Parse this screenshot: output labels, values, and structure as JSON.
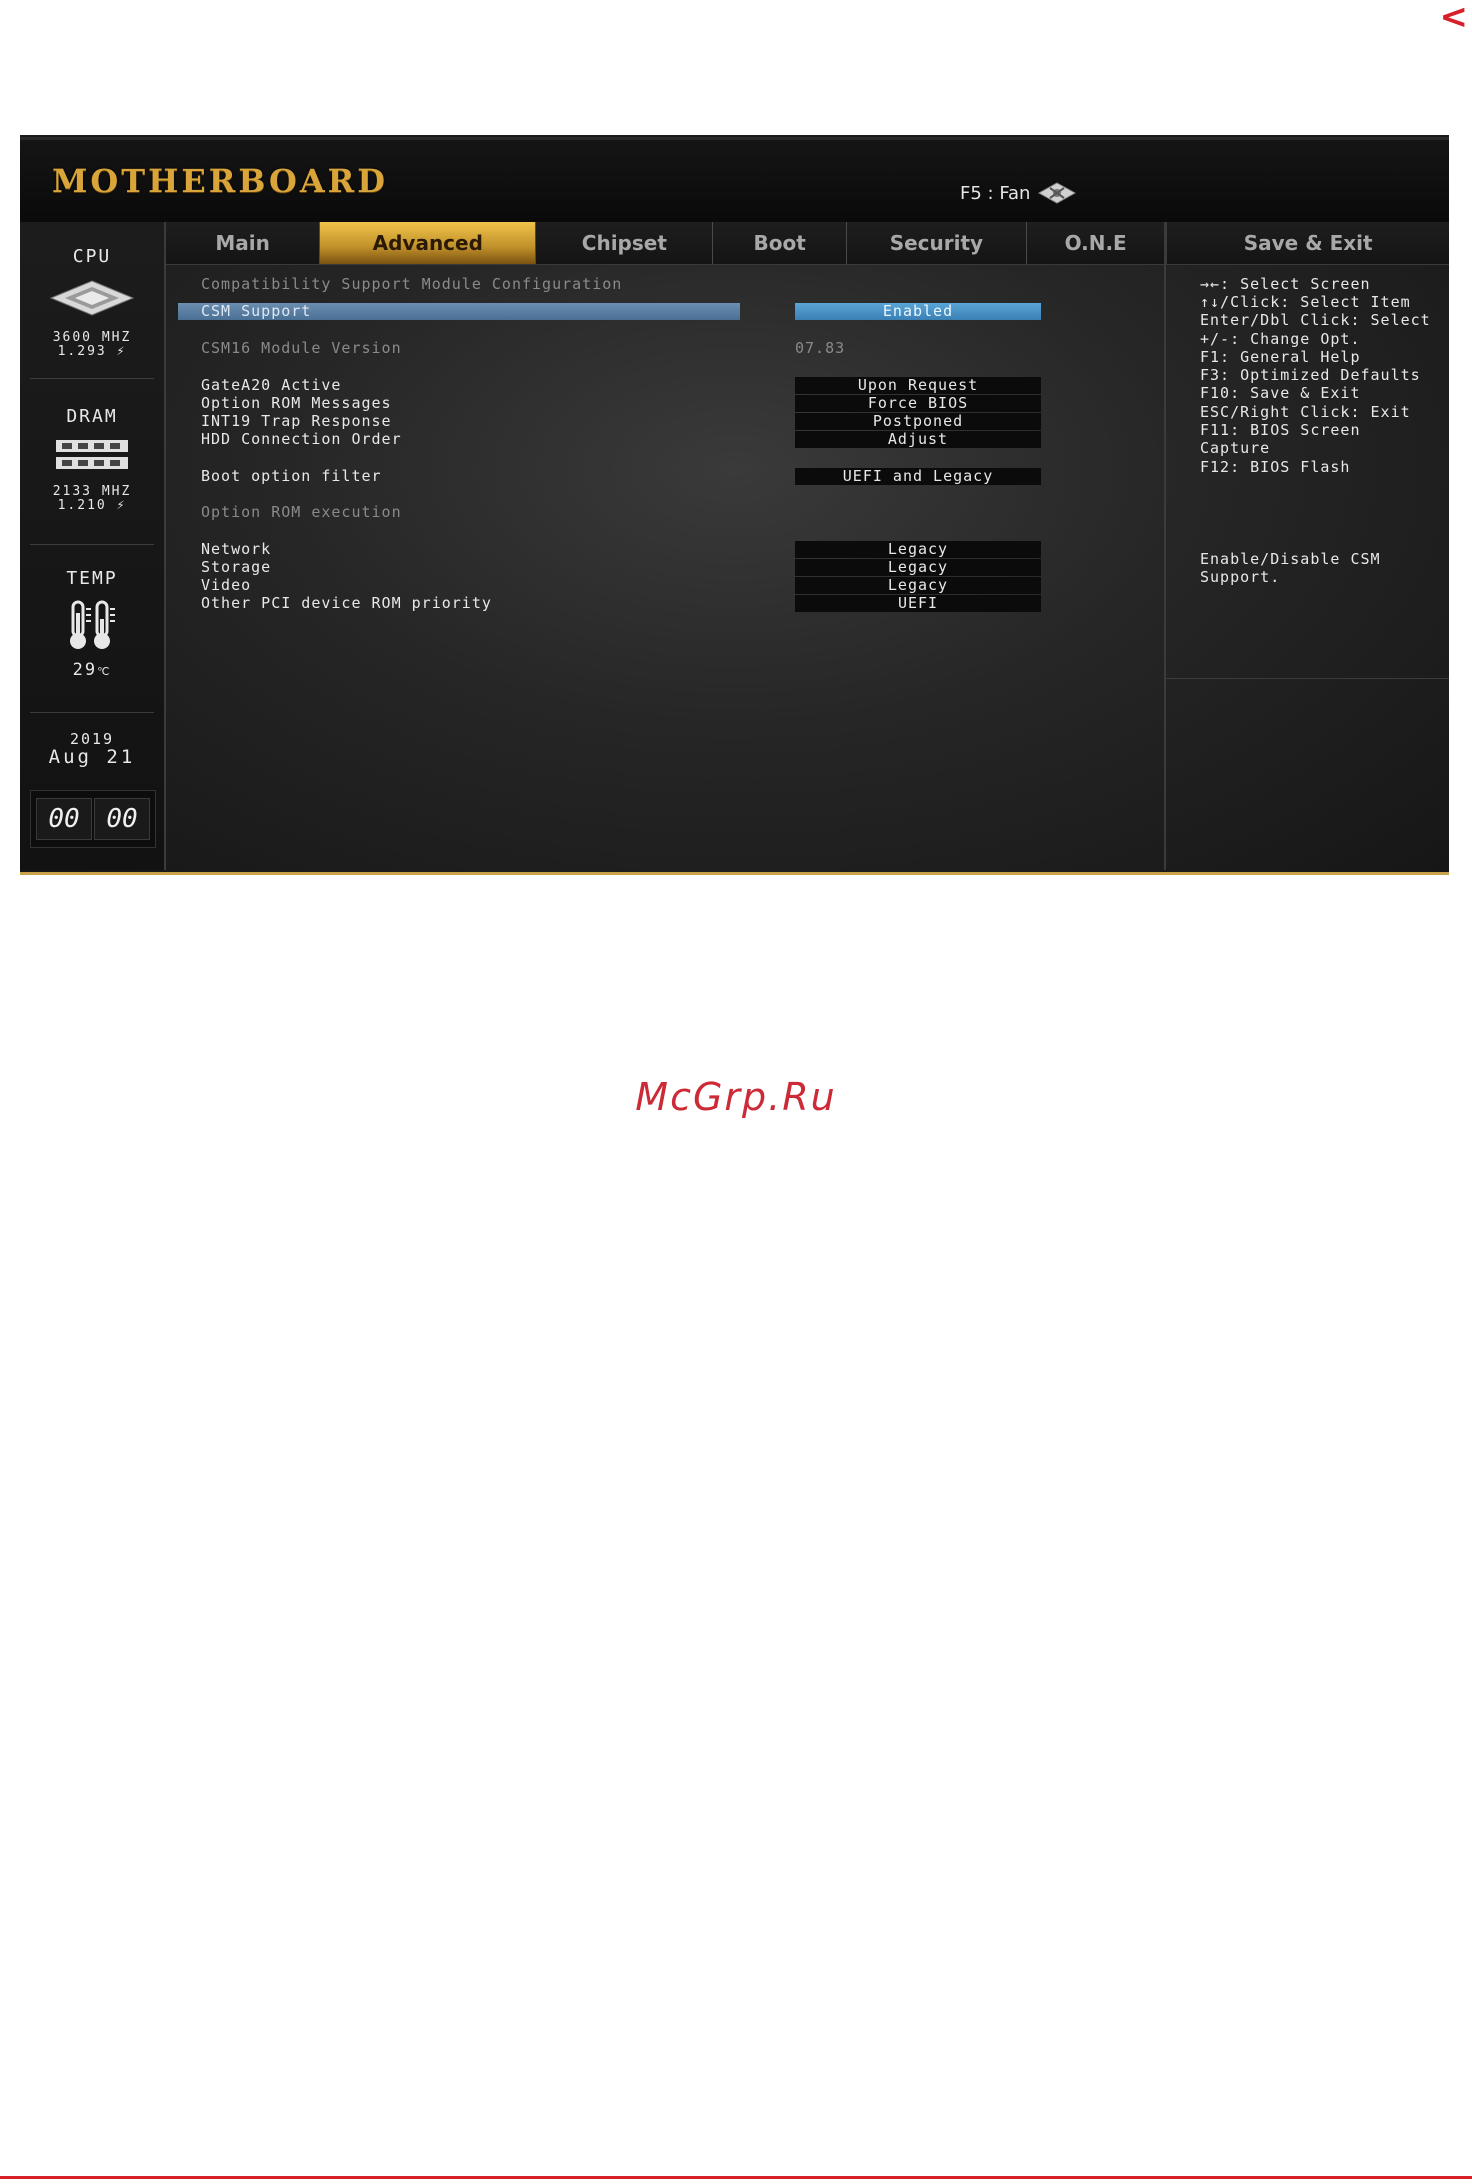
{
  "page": {
    "nav_arrow": "<",
    "watermark": "McGrp.Ru"
  },
  "header": {
    "brand": "MOTHERBOARD",
    "fan_label": "F5 : Fan"
  },
  "sidebar": {
    "cpu": {
      "title": "CPU",
      "freq": "3600 MHZ",
      "volt": "1.293"
    },
    "dram": {
      "title": "DRAM",
      "freq": "2133 MHZ",
      "volt": "1.210"
    },
    "temp": {
      "title": "TEMP",
      "value": "29"
    },
    "date": {
      "year": "2019",
      "month_day": "Aug 21"
    },
    "clock": {
      "hours": "00",
      "minutes": "00"
    }
  },
  "tabs": [
    "Main",
    "Advanced",
    "Chipset",
    "Boot",
    "Security",
    "O.N.E",
    "Save & Exit"
  ],
  "active_tab": "Advanced",
  "main": {
    "section_title": "Compatibility Support Module Configuration",
    "csm_support": {
      "label": "CSM Support",
      "value": "Enabled"
    },
    "csm16_version": {
      "label": "CSM16 Module Version",
      "value": "07.83"
    },
    "gatea20": {
      "label": "GateA20 Active",
      "value": "Upon Request"
    },
    "option_rom_messages": {
      "label": "Option ROM Messages",
      "value": "Force BIOS"
    },
    "int19": {
      "label": "INT19 Trap Response",
      "value": "Postponed"
    },
    "hdd_order": {
      "label": "HDD Connection Order",
      "value": "Adjust"
    },
    "boot_filter": {
      "label": "Boot option filter",
      "value": "UEFI and Legacy"
    },
    "option_rom_exec": "Option ROM execution",
    "network": {
      "label": "Network",
      "value": "Legacy"
    },
    "storage": {
      "label": "Storage",
      "value": "Legacy"
    },
    "video": {
      "label": "Video",
      "value": "Legacy"
    },
    "other_pci": {
      "label": "Other PCI device ROM priority",
      "value": "UEFI"
    }
  },
  "help": {
    "keys": [
      "→←: Select Screen",
      "↑↓/Click: Select Item",
      "Enter/Dbl Click: Select",
      "+/-: Change Opt.",
      "F1: General Help",
      "F3: Optimized Defaults",
      "F10: Save & Exit",
      "ESC/Right Click: Exit",
      "F11: BIOS Screen",
      "Capture",
      "F12: BIOS Flash"
    ],
    "description": [
      "Enable/Disable CSM",
      "Support."
    ]
  },
  "colors": {
    "accent_gold": "#d9a53a",
    "selection_blue": "#4a8fc2",
    "watermark_red": "#cc2a36"
  }
}
